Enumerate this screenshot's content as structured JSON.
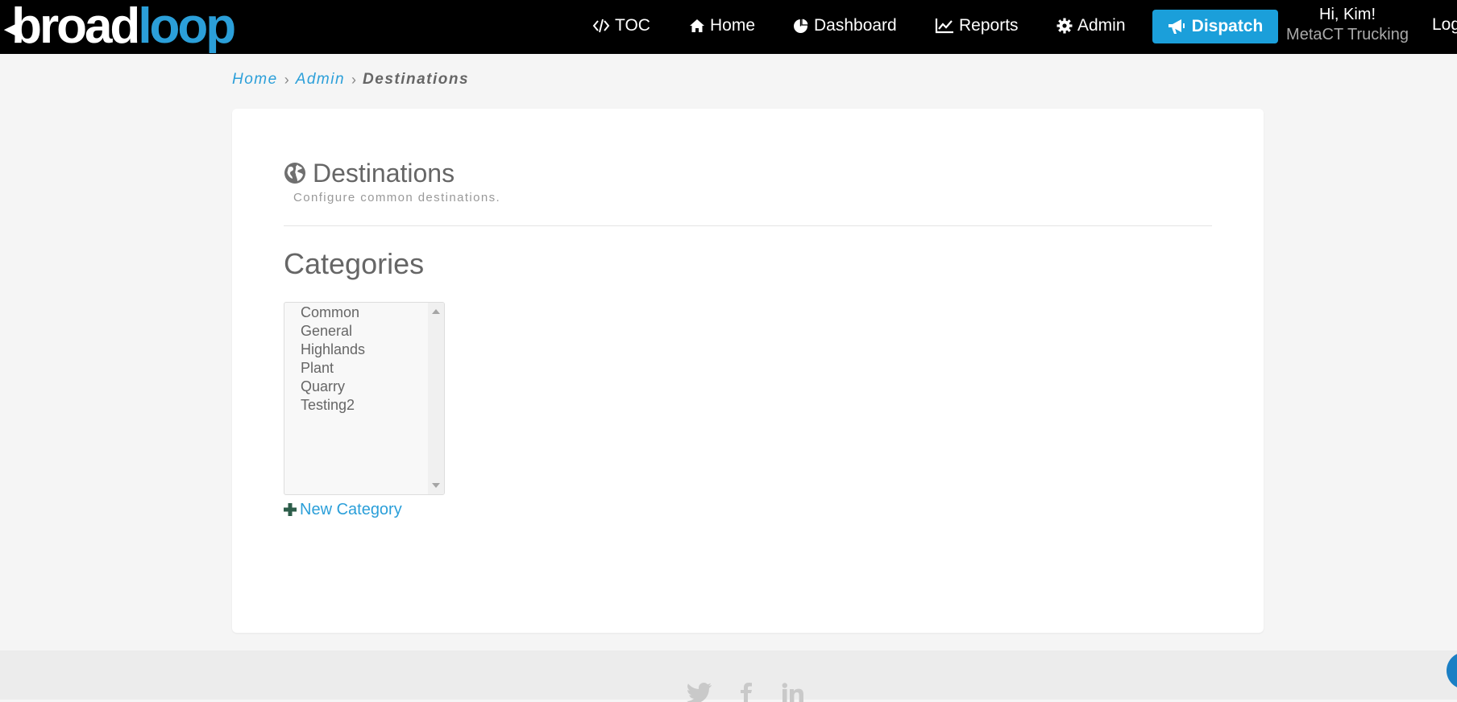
{
  "brand": {
    "logo_part1": "broad",
    "logo_part2": "loop",
    "logo_color": "#2b9fd9"
  },
  "nav": {
    "items": [
      {
        "label": "TOC",
        "icon": "code-icon"
      },
      {
        "label": "Home",
        "icon": "home-icon"
      },
      {
        "label": "Dashboard",
        "icon": "pie-chart-icon"
      },
      {
        "label": "Reports",
        "icon": "line-chart-icon"
      },
      {
        "label": "Admin",
        "icon": "gear-icon"
      }
    ],
    "dispatch_label": "Dispatch",
    "dispatch_icon": "bullhorn-icon",
    "dispatch_color": "#1b9fda",
    "user_greeting": "Hi, Kim!",
    "user_company": "MetaCT Trucking",
    "logout_label": "Log"
  },
  "breadcrumb": {
    "items": [
      "Home",
      "Admin"
    ],
    "current": "Destinations"
  },
  "page": {
    "title": "Destinations",
    "title_icon": "globe-icon",
    "subtitle": "Configure common destinations.",
    "section_title": "Categories",
    "categories": [
      "Common",
      "General",
      "Highlands",
      "Plant",
      "Quarry",
      "Testing2"
    ],
    "new_category_label": "New Category",
    "new_category_icon": "plus-icon"
  },
  "footer": {
    "social_icons": [
      "twitter-icon",
      "facebook-icon",
      "linkedin-icon"
    ]
  }
}
